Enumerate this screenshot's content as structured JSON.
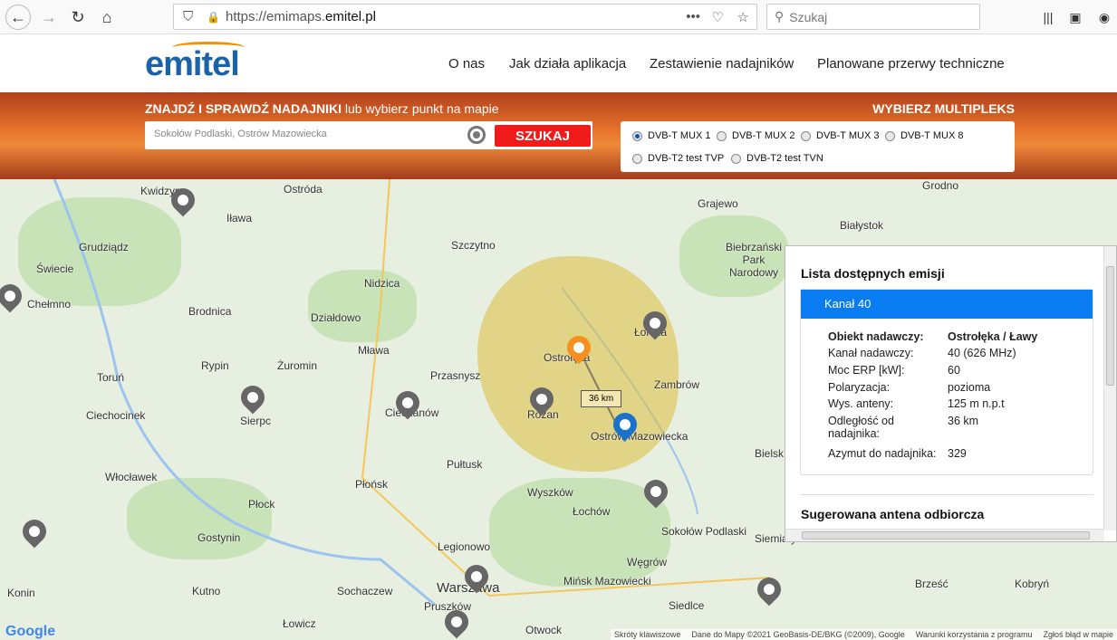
{
  "browser": {
    "url_prefix": "https://emimaps.",
    "url_domain": "emitel.pl",
    "search_placeholder": "Szukaj"
  },
  "header": {
    "logo": "emitel",
    "nav": [
      "O nas",
      "Jak działa aplikacja",
      "Zestawienie nadajników",
      "Planowane przerwy techniczne"
    ]
  },
  "banner": {
    "title_bold": "ZNAJDŹ I SPRAWDŹ NADAJNIKI",
    "title_rest": " lub wybierz punkt na mapie",
    "search_value": "Sokołów Podlaski, Ostrów Mazowiecka",
    "search_button": "SZUKAJ",
    "multiplex_title": "WYBIERZ MULTIPLEKS",
    "multiplex_options": [
      "DVB-T MUX 1",
      "DVB-T MUX 2",
      "DVB-T MUX 3",
      "DVB-T MUX 8",
      "DVB-T2 test TVP",
      "DVB-T2 test TVN"
    ],
    "selected": "DVB-T MUX 1"
  },
  "map": {
    "cities": [
      "Kwidzyn",
      "Ostróda",
      "Iława",
      "Szczytno",
      "Grajewo",
      "Grudziądz",
      "Świecie",
      "Chełmno",
      "Nidzica",
      "Brodnica",
      "Działdowo",
      "Łomża",
      "Rypin",
      "Żuromin",
      "Mława",
      "Przasnysz",
      "Ostrołęka",
      "Toruń",
      "Sierpc",
      "Ciechanów",
      "Różan",
      "Zambrów",
      "Ciechocinek",
      "Płońsk",
      "Pułtusk",
      "Włocławek",
      "Płock",
      "Wyszków",
      "Łochów",
      "Sokołów Podlaski",
      "Gostynin",
      "Legionowo",
      "Węgrów",
      "Warszawa",
      "Mińsk Mazowiecki",
      "Siedlce",
      "Kutno",
      "Sochaczew",
      "Pruszków",
      "Łowicz",
      "Otwock",
      "Konin",
      "Białystok",
      "Grodno",
      "Biebrzański Park Narodowy",
      "Ostrów Mazowiecka",
      "Bielsk",
      "Siemiatycze",
      "Kobryń",
      "Brześć"
    ],
    "distance_label": "36 km",
    "google": "Google",
    "footer": [
      "Skróty klawiszowe",
      "Dane do Mapy ©2021 GeoBasis-DE/BKG (©2009), Google",
      "Warunki korzystania z programu",
      "Zgłoś błąd w mapie"
    ]
  },
  "panel": {
    "title": "Lista dostępnych emisji",
    "channel": "Kanał 40",
    "rows": [
      [
        "Obiekt nadawczy:",
        "Ostrołęka / Ławy"
      ],
      [
        "Kanał nadawczy:",
        "40 (626 MHz)"
      ],
      [
        "Moc ERP [kW]:",
        "60"
      ],
      [
        "Polaryzacja:",
        "pozioma"
      ],
      [
        "Wys. anteny:",
        "125 m n.p.t"
      ],
      [
        "Odległość od nadajnika:",
        "36 km"
      ],
      [
        "Azymut do nadajnika:",
        "329"
      ]
    ],
    "antenna_title": "Sugerowana antena odbiorcza"
  },
  "colors": {
    "accent": "#0a7cf2",
    "search_button": "#f01c1c",
    "logo": "#1a63a8"
  }
}
